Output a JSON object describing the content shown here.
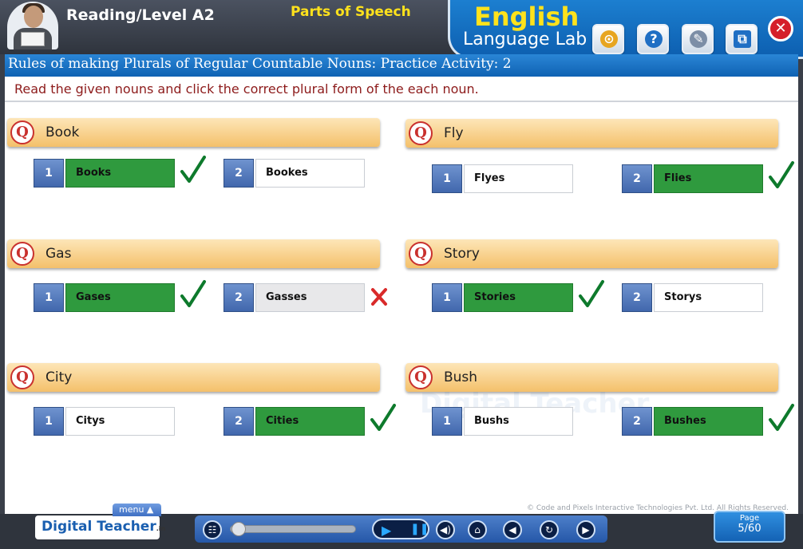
{
  "header": {
    "level_title": "Reading/Level A2",
    "topic": "Parts of Speech",
    "lab_title_line1": "English",
    "lab_title_line2": "Language Lab",
    "tools": [
      "dictionary-icon",
      "help-icon",
      "book-icon",
      "window-icon"
    ],
    "close_label": "✕"
  },
  "subtitle": "Rules of making Plurals of Regular Countable Nouns: Practice Activity: 2",
  "instruction": "Read the given nouns and click the correct plural form of the each noun.",
  "questions": [
    {
      "badge": "Q",
      "word": "Book",
      "options": [
        {
          "num": "1",
          "text": "Books",
          "state": "correct"
        },
        {
          "num": "2",
          "text": "Bookes",
          "state": "none"
        }
      ]
    },
    {
      "badge": "Q",
      "word": "Fly",
      "options": [
        {
          "num": "1",
          "text": "Flyes",
          "state": "none"
        },
        {
          "num": "2",
          "text": "Flies",
          "state": "correct"
        }
      ]
    },
    {
      "badge": "Q",
      "word": "Gas",
      "options": [
        {
          "num": "1",
          "text": "Gases",
          "state": "correct"
        },
        {
          "num": "2",
          "text": "Gasses",
          "state": "wrong"
        }
      ]
    },
    {
      "badge": "Q",
      "word": "Story",
      "options": [
        {
          "num": "1",
          "text": "Stories",
          "state": "correct"
        },
        {
          "num": "2",
          "text": "Storys",
          "state": "none"
        }
      ]
    },
    {
      "badge": "Q",
      "word": "City",
      "options": [
        {
          "num": "1",
          "text": "Citys",
          "state": "none"
        },
        {
          "num": "2",
          "text": "Cities",
          "state": "correct"
        }
      ]
    },
    {
      "badge": "Q",
      "word": "Bush",
      "options": [
        {
          "num": "1",
          "text": "Bushs",
          "state": "none"
        },
        {
          "num": "2",
          "text": "Bushes",
          "state": "correct"
        }
      ]
    }
  ],
  "watermark": "Digital Teacher",
  "footer": {
    "copyright": "© Code and Pixels Interactive Technologies Pvt. Ltd. All Rights Reserved.",
    "logo_text": "Digital Teacher",
    "logo_suffix": ".in",
    "menu_label": "menu ▲",
    "page_label": "Page",
    "page_number": "5/60"
  },
  "colors": {
    "correct": "#2f9a3e",
    "question_bar": "#f4c06a",
    "header_blue": "#0d5fb0",
    "instruction_text": "#8d1b1b"
  }
}
